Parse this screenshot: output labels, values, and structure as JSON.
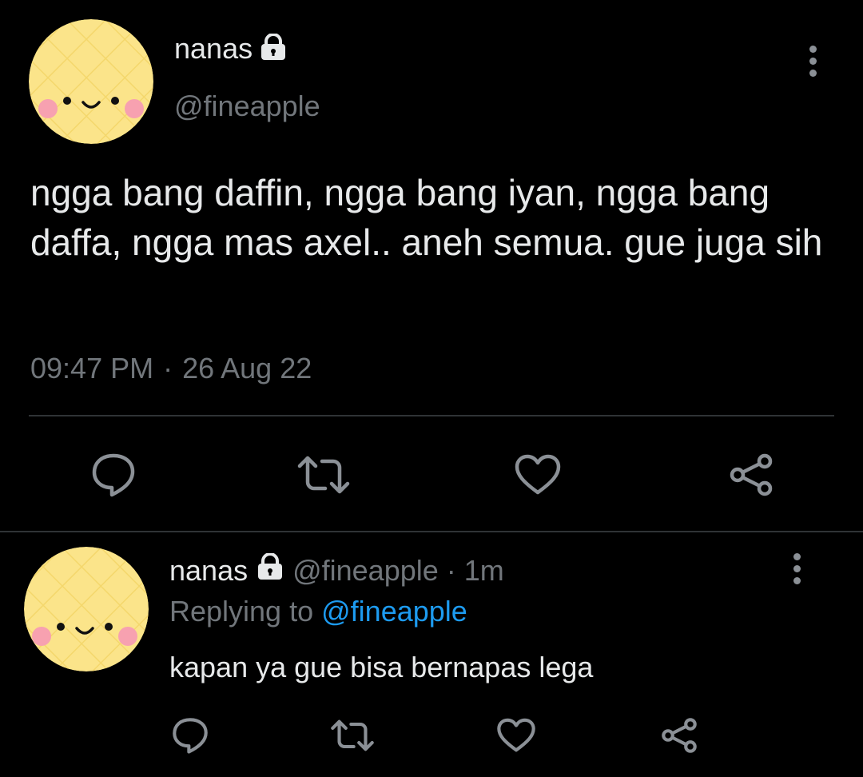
{
  "tweet": {
    "display_name": "nanas",
    "handle": "@fineapple",
    "text": "ngga bang daffin, ngga bang iyan, ngga bang daffa, ngga mas axel.. aneh semua. gue juga sih",
    "time": "09:47 PM",
    "separator": "·",
    "date": "26 Aug 22"
  },
  "reply": {
    "display_name": "nanas",
    "handle": "@fineapple",
    "separator": "·",
    "age": "1m",
    "replying_label": "Replying to",
    "replying_handle": "@fineapple",
    "text": "kapan ya gue bisa bernapas lega"
  },
  "icons": {
    "lock": "lock-icon",
    "more": "more-vertical-icon",
    "reply": "comment-bubble-icon",
    "retweet": "retweet-icon",
    "like": "heart-icon",
    "share": "share-icon"
  },
  "colors": {
    "background": "#000000",
    "text": "#e7e9ea",
    "secondary": "#71767b",
    "link": "#1d9bf0",
    "avatar_fill": "#fbe48a",
    "avatar_cheek": "#f7a1b0"
  }
}
